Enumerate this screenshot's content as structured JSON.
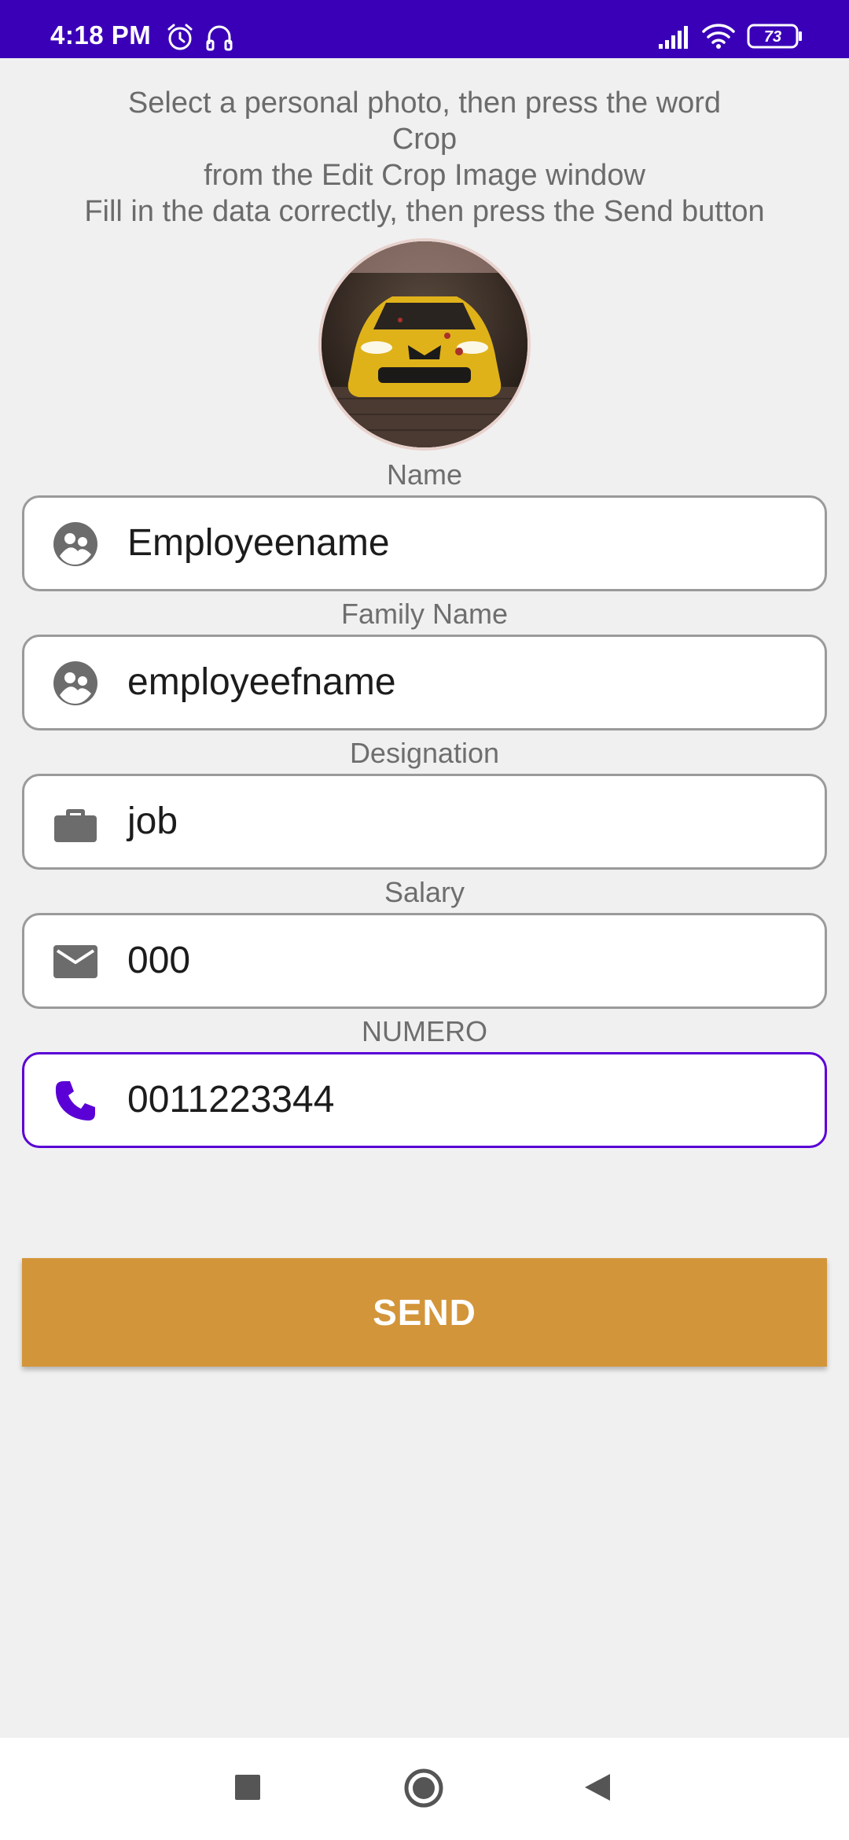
{
  "status_bar": {
    "time": "4:18 PM",
    "battery": "73",
    "background_color": "#3a00b8",
    "icons": [
      "alarm-icon",
      "headset-icon",
      "signal-icon",
      "wifi-icon",
      "battery-icon"
    ]
  },
  "instructions": {
    "line1": "Select a personal photo, then press the word",
    "line2": "Crop",
    "line3": "from the Edit Crop Image window",
    "line4": "Fill in the data correctly, then press the Send button"
  },
  "form": {
    "name": {
      "label": "Name",
      "value": "Employeename",
      "icon": "person-icon"
    },
    "family_name": {
      "label": "Family Name",
      "value": "employeefname",
      "icon": "person-icon"
    },
    "designation": {
      "label": "Designation",
      "value": "job",
      "icon": "briefcase-icon"
    },
    "salary": {
      "label": "Salary",
      "value": "000",
      "icon": "mail-icon"
    },
    "numero": {
      "label": "NUMERO",
      "value": "0011223344",
      "icon": "phone-icon"
    }
  },
  "send_button": {
    "label": "SEND",
    "color": "#d3953a"
  },
  "accent_color": "#5a00d6",
  "nav_bar": {
    "icons": [
      "recents-square-icon",
      "home-circle-icon",
      "back-triangle-icon"
    ]
  }
}
